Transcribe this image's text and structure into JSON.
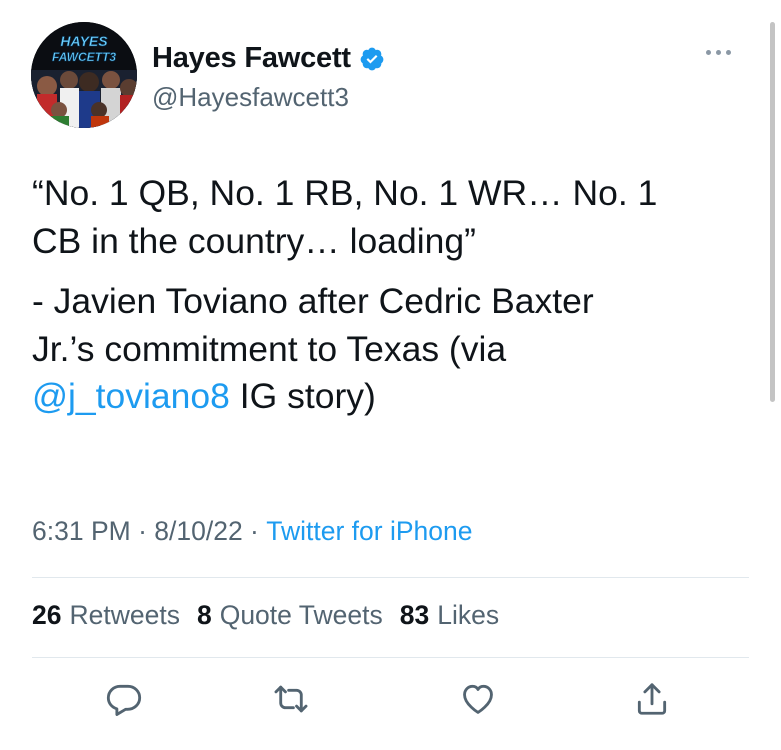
{
  "author": {
    "name": "Hayes Fawcett",
    "handle": "@Hayesfawcett3",
    "avatar_text_line1": "HAYES",
    "avatar_text_line2": "FAWCETT3"
  },
  "tweet": {
    "line1": "“No. 1 QB, No. 1 RB, No. 1 WR… No. 1",
    "line2": "CB in the country… loading”",
    "line3": "- Javien Toviano after Cedric Baxter",
    "line4": "Jr.’s commitment to Texas (via",
    "mention": "@j_toviano8",
    "line5_rest": " IG story)"
  },
  "meta": {
    "time": "6:31 PM",
    "sep1": " · ",
    "date": "8/10/22",
    "sep2": " · ",
    "source": "Twitter for iPhone"
  },
  "stats": {
    "retweets_count": "26",
    "retweets_label": "Retweets",
    "quotes_count": "8",
    "quotes_label": "Quote Tweets",
    "likes_count": "83",
    "likes_label": "Likes"
  },
  "icons": {
    "verified": "verified-badge-icon",
    "more": "more-horizontal-icon",
    "reply": "reply-icon",
    "retweet": "retweet-icon",
    "like": "heart-icon",
    "share": "share-icon"
  },
  "colors": {
    "accent": "#1d9bf0",
    "secondary_text": "#536471",
    "icon": "#536471"
  }
}
